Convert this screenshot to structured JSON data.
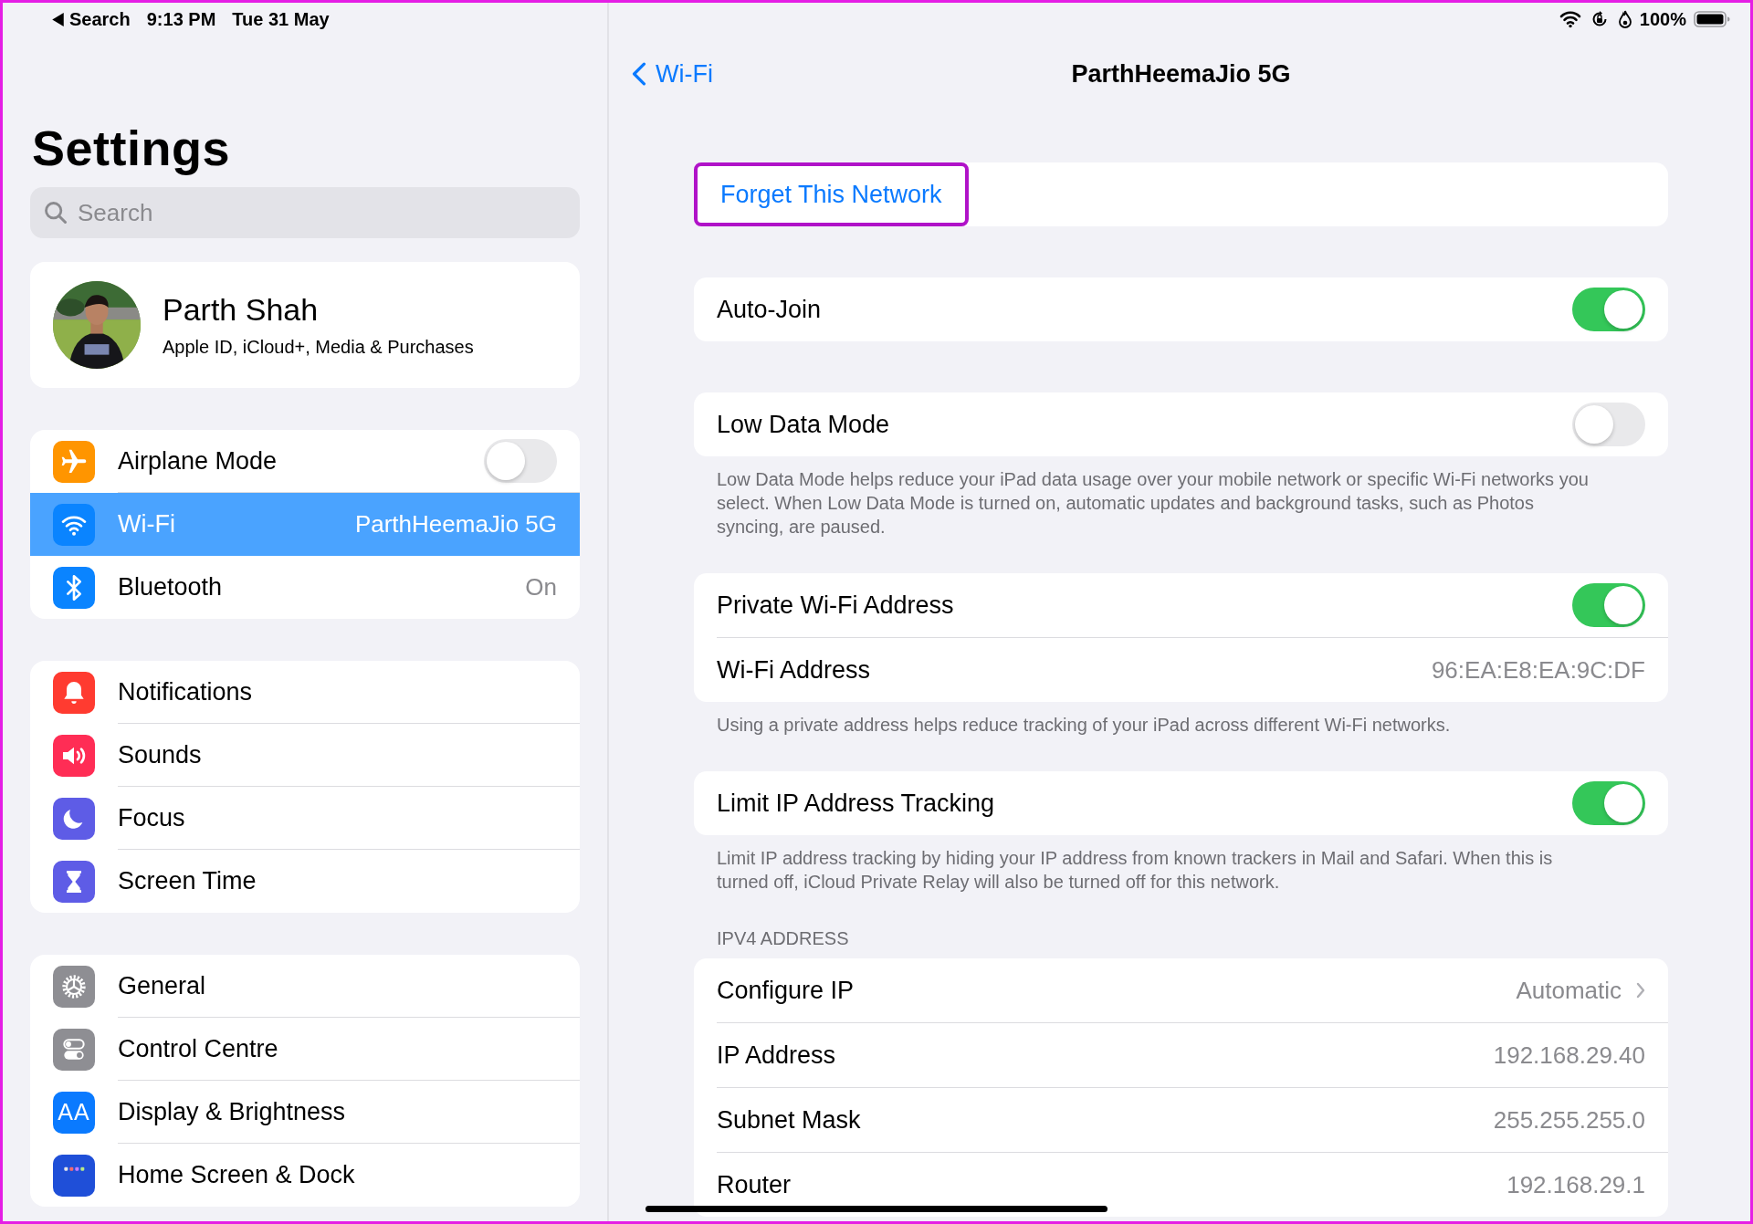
{
  "status_bar": {
    "back_label": "Search",
    "time": "9:13 PM",
    "date": "Tue 31 May",
    "battery": "100%"
  },
  "sidebar": {
    "title": "Settings",
    "search": {
      "placeholder": "Search"
    },
    "profile": {
      "name": "Parth Shah",
      "subtitle": "Apple ID, iCloud+, Media & Purchases"
    },
    "groups": [
      {
        "items": [
          {
            "label": "Airplane Mode",
            "kind": "toggle",
            "on": false,
            "selected": false,
            "color": "#ff9500"
          },
          {
            "label": "Wi-Fi",
            "kind": "value",
            "value": "ParthHeemaJio 5G",
            "selected": true,
            "color": "#0a84ff"
          },
          {
            "label": "Bluetooth",
            "kind": "value",
            "value": "On",
            "selected": false,
            "color": "#0a84ff"
          }
        ]
      },
      {
        "items": [
          {
            "label": "Notifications",
            "kind": "link",
            "selected": false,
            "color": "#ff3b30"
          },
          {
            "label": "Sounds",
            "kind": "link",
            "selected": false,
            "color": "#ff2d55"
          },
          {
            "label": "Focus",
            "kind": "link",
            "selected": false,
            "color": "#5e5ce6"
          },
          {
            "label": "Screen Time",
            "kind": "link",
            "selected": false,
            "color": "#5e5ce6"
          }
        ]
      },
      {
        "items": [
          {
            "label": "General",
            "kind": "link",
            "selected": false,
            "color": "#8e8e93"
          },
          {
            "label": "Control Centre",
            "kind": "link",
            "selected": false,
            "color": "#8e8e93"
          },
          {
            "label": "Display & Brightness",
            "kind": "link",
            "selected": false,
            "color": "#0a7aff",
            "icon_text": "AA"
          },
          {
            "label": "Home Screen & Dock",
            "kind": "link",
            "selected": false,
            "color": "#1f4fd8"
          }
        ]
      }
    ]
  },
  "detail": {
    "back": "Wi-Fi",
    "title": "ParthHeemaJio 5G",
    "forget": {
      "label": "Forget This Network",
      "highlighted": true
    },
    "sections": [
      {
        "rows": [
          {
            "kind": "toggle",
            "label": "Auto-Join",
            "on": true
          }
        ]
      },
      {
        "rows": [
          {
            "kind": "toggle",
            "label": "Low Data Mode",
            "on": false
          }
        ],
        "footer": "Low Data Mode helps reduce your iPad data usage over your mobile network or specific Wi-Fi networks you select. When Low Data Mode is turned on, automatic updates and background tasks, such as Photos syncing, are paused."
      },
      {
        "rows": [
          {
            "kind": "toggle",
            "label": "Private Wi-Fi Address",
            "on": true
          },
          {
            "kind": "value",
            "label": "Wi-Fi Address",
            "value": "96:EA:E8:EA:9C:DF"
          }
        ],
        "footer": "Using a private address helps reduce tracking of your iPad across different Wi-Fi networks."
      },
      {
        "rows": [
          {
            "kind": "toggle",
            "label": "Limit IP Address Tracking",
            "on": true
          }
        ],
        "footer": "Limit IP address tracking by hiding your IP address from known trackers in Mail and Safari. When this is turned off, iCloud Private Relay will also be turned off for this network."
      },
      {
        "header": "IPV4 ADDRESS",
        "rows": [
          {
            "kind": "chevron",
            "label": "Configure IP",
            "value": "Automatic"
          },
          {
            "kind": "value",
            "label": "IP Address",
            "value": "192.168.29.40"
          },
          {
            "kind": "value",
            "label": "Subnet Mask",
            "value": "255.255.255.0"
          },
          {
            "kind": "value",
            "label": "Router",
            "value": "192.168.29.1"
          }
        ]
      }
    ]
  }
}
